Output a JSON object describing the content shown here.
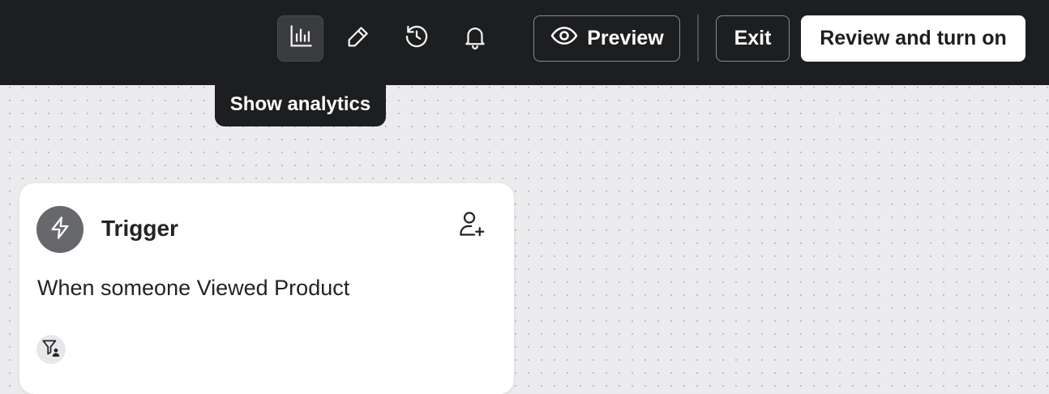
{
  "toolbar": {
    "tools": [
      {
        "name": "analytics",
        "icon": "bar-chart-icon",
        "active": true
      },
      {
        "name": "edit",
        "icon": "pencil-icon",
        "active": false
      },
      {
        "name": "history",
        "icon": "history-icon",
        "active": false
      },
      {
        "name": "notifications",
        "icon": "bell-icon",
        "active": false
      }
    ],
    "preview_label": "Preview",
    "exit_label": "Exit",
    "review_label": "Review and turn on"
  },
  "tooltip": {
    "text": "Show analytics"
  },
  "trigger_card": {
    "title": "Trigger",
    "description": "When someone Viewed Product",
    "icon": "lightning-icon",
    "action_icon": "add-person-icon",
    "filter_icon": "filter-person-icon"
  },
  "colors": {
    "topbar_bg": "#1d1e20",
    "canvas_bg": "#ececee",
    "primary_button_bg": "#ffffff",
    "trigger_icon_bg": "#67686b"
  }
}
